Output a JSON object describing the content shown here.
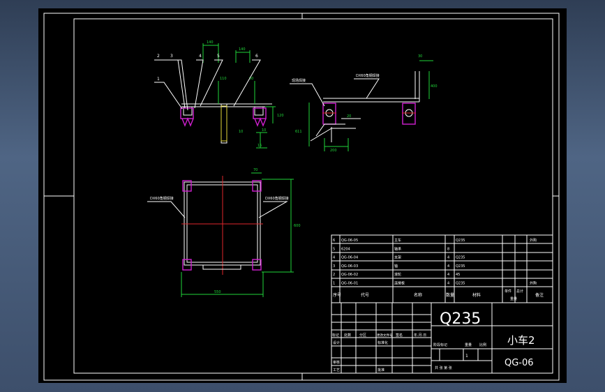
{
  "balloons": [
    "1",
    "2",
    "3",
    "4",
    "5",
    "6"
  ],
  "dims": {
    "d140a": "140",
    "d140b": "140",
    "d110": "110",
    "d60": "60",
    "d120": "120",
    "d10": "10",
    "d15": "15",
    "d30": "30",
    "d400": "400",
    "d611": "611",
    "d200": "200",
    "d20": "20",
    "d70": "70",
    "d600": "600",
    "d550": "550"
  },
  "callouts": {
    "weld": "现场焊接",
    "bracket": "DX60角钢焊接",
    "left_plan": "DX60角钢焊接",
    "right_plan": "DX60角钢焊接"
  },
  "bom": {
    "rows": [
      {
        "seq": "6",
        "code": "QG-06-05",
        "name": "主车",
        "qty": "",
        "material": "Q235",
        "note": "外购"
      },
      {
        "seq": "5",
        "code": "6204",
        "name": "轴承",
        "qty": "8",
        "material": "",
        "note": ""
      },
      {
        "seq": "4",
        "code": "QG-06-04",
        "name": "支架",
        "qty": "4",
        "material": "Q235",
        "note": ""
      },
      {
        "seq": "3",
        "code": "QG-06-03",
        "name": "轴",
        "qty": "4",
        "material": "Q235",
        "note": ""
      },
      {
        "seq": "2",
        "code": "QG-06-02",
        "name": "滚轮",
        "qty": "4",
        "material": "45",
        "note": ""
      },
      {
        "seq": "1",
        "code": "QG-06-01",
        "name": "连接板",
        "qty": "4",
        "material": "Q235",
        "note": "外购"
      }
    ],
    "header": {
      "seq": "序号",
      "code": "代号",
      "name": "名称",
      "qty": "数量",
      "material": "材料",
      "unit": "单件",
      "total": "总计",
      "weight": "重量",
      "note": "备注"
    }
  },
  "titleblock": {
    "material": "Q235",
    "title": "小车2",
    "drawing_no": "QG-06",
    "mark_labels": [
      "标记",
      "处数",
      "分区",
      "更改文件号",
      "签名",
      "年.月.日"
    ],
    "design": "设计",
    "std": "标准化",
    "audit": "审核",
    "process": "工艺",
    "approve": "批准",
    "stage": "阶段标记",
    "weight": "重量",
    "scale": "比例",
    "scale_value": "1",
    "sheets": "共 张 第 张"
  }
}
